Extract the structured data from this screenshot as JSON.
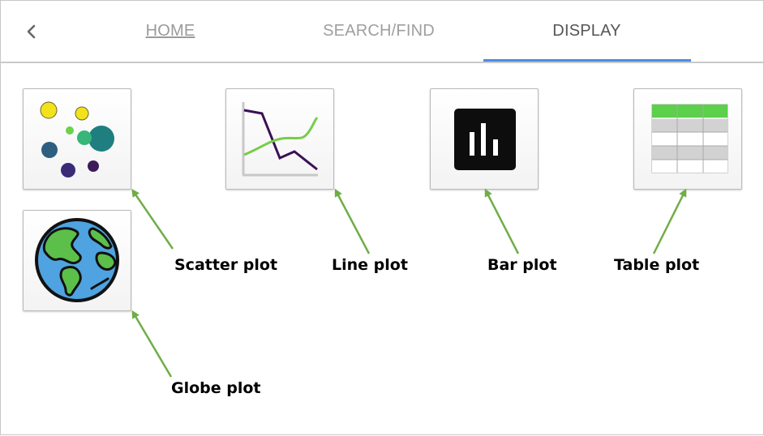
{
  "tabs": [
    {
      "label": "HOME"
    },
    {
      "label": "SEARCH/FIND"
    },
    {
      "label": "DISPLAY",
      "active": true
    }
  ],
  "colors": {
    "active_indicator": "#4a8be6",
    "arrow": "#70ad47",
    "bar_icon_bg": "#0d0d0d",
    "table_header": "#5ccf4b",
    "globe_ocean": "#4fa3e0",
    "globe_land": "#5cbf4a"
  },
  "tiles": [
    {
      "icon": "scatter-plot-icon",
      "caption": "Scatter plot"
    },
    {
      "icon": "line-plot-icon",
      "caption": "Line plot"
    },
    {
      "icon": "bar-plot-icon",
      "caption": "Bar plot"
    },
    {
      "icon": "table-plot-icon",
      "caption": "Table plot"
    },
    {
      "icon": "globe-plot-icon",
      "caption": "Globe plot"
    }
  ]
}
